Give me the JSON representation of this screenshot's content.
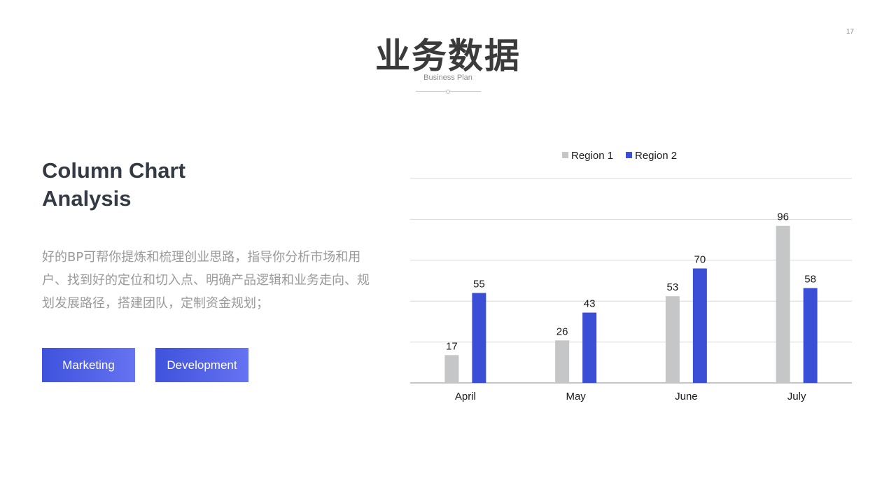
{
  "header": {
    "title": "业务数据",
    "subtitle": "Business Plan",
    "page_number": "17"
  },
  "left": {
    "heading_line1": "Column Chart",
    "heading_line2": "Analysis",
    "description": "好的BP可帮你提炼和梳理创业思路，指导你分析市场和用户、找到好的定位和切入点、明确产品逻辑和业务走向、规划发展路径，搭建团队，定制资金规划；",
    "buttons": {
      "marketing": "Marketing",
      "development": "Development"
    }
  },
  "colors": {
    "region1": "#c4c6c8",
    "region2": "#3b4fd6",
    "grid": "#d9d9d9",
    "axis": "#8c8c8c"
  },
  "chart_data": {
    "type": "bar",
    "title": "",
    "xlabel": "",
    "ylabel": "",
    "categories": [
      "April",
      "May",
      "June",
      "July"
    ],
    "series": [
      {
        "name": "Region 1",
        "values": [
          17,
          26,
          53,
          96
        ]
      },
      {
        "name": "Region 2",
        "values": [
          55,
          43,
          70,
          58
        ]
      }
    ],
    "ylim": [
      0,
      125
    ],
    "grid": true,
    "legend": "top-center",
    "data_labels": true
  }
}
